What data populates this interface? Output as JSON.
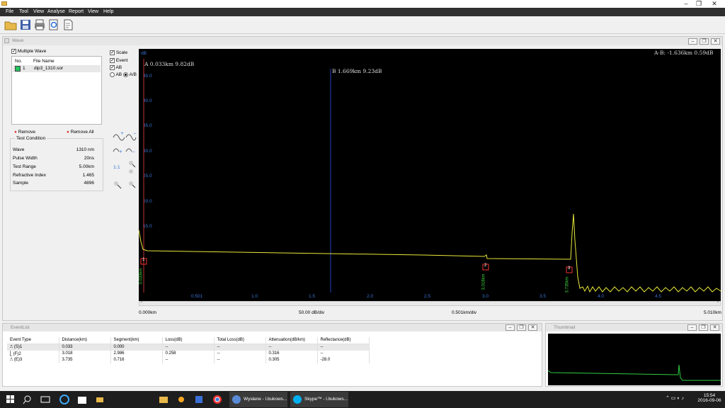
{
  "menu": [
    "File",
    "Tool",
    "View",
    "Analyse",
    "Report",
    "View",
    "Help"
  ],
  "wave_window": {
    "title": "Wave"
  },
  "file_panel": {
    "multiple_wave": "Multiple Wave",
    "col_no": "No.",
    "col_file": "File Name",
    "file_no": "1",
    "file_name": "dip3_1310.sor",
    "file_color": "#22c55e",
    "remove": "Remove",
    "remove_all": "Remove All"
  },
  "options": {
    "scale": "Scale",
    "event": "Event",
    "ab": "AB",
    "radio_ab": "AB",
    "radio_a_b": "A/B"
  },
  "test_condition": {
    "title": "Test Condition",
    "rows": [
      {
        "label": "Wave",
        "value": "1310 nm"
      },
      {
        "label": "Pulse Width",
        "value": "20ns"
      },
      {
        "label": "Test Range",
        "value": "5.00km"
      },
      {
        "label": "Refractive Index",
        "value": "1.465"
      },
      {
        "label": "Sample",
        "value": "4896"
      }
    ]
  },
  "plot": {
    "unit": "dB",
    "y_ticks": [
      "45.0",
      "40.0",
      "35.0",
      "30.0",
      "25.0",
      "20.0",
      "15.0"
    ],
    "x_ticks": [
      "0.501",
      "1.0",
      "1.5",
      "2.0",
      "2.5",
      "3.0",
      "3.5",
      "4.0",
      "4.5"
    ],
    "cursor_a": "A 0.033km 9.82dB",
    "cursor_b": "B 1.669km 9.23dB",
    "delta": "A-B: -1.636km 0.59dB",
    "marker1_id": "1",
    "marker1": "0.033km",
    "marker2_id": "2",
    "marker2": "3.018km",
    "marker3_id": "3",
    "marker3": "3.735km",
    "trace_color": "#e8e83a",
    "grid_color": "#3b74d6"
  },
  "scale_bar": {
    "start": "0.000km",
    "ydiv": "50.00 dB/div",
    "xdiv": "0.501km/div",
    "end": "5.010km"
  },
  "event_list": {
    "title": "EventList",
    "headers": [
      "Event Type",
      "Distance(km)",
      "Segment(km)",
      "Loss(dB)",
      "Total Loss(dB)",
      "Attenuation(dB/km)",
      "Reflectance(dB)"
    ],
    "rows": [
      [
        "(S)1",
        "0.033",
        "0.000",
        "--",
        "--",
        "--",
        "--"
      ],
      [
        "(F)2",
        "3.018",
        "2.986",
        "0.258",
        "--",
        "0.316",
        "--"
      ],
      [
        "(E)3",
        "3.735",
        "0.716",
        "--",
        "--",
        "0.305",
        "-28.0"
      ]
    ]
  },
  "thumbnail": {
    "title": "Thumbnail"
  },
  "taskbar": {
    "items": [
      "Wysłane - l.bukows...",
      "Skype™ - l.bukows..."
    ],
    "time": "15:54",
    "date": "2016-09-06"
  }
}
